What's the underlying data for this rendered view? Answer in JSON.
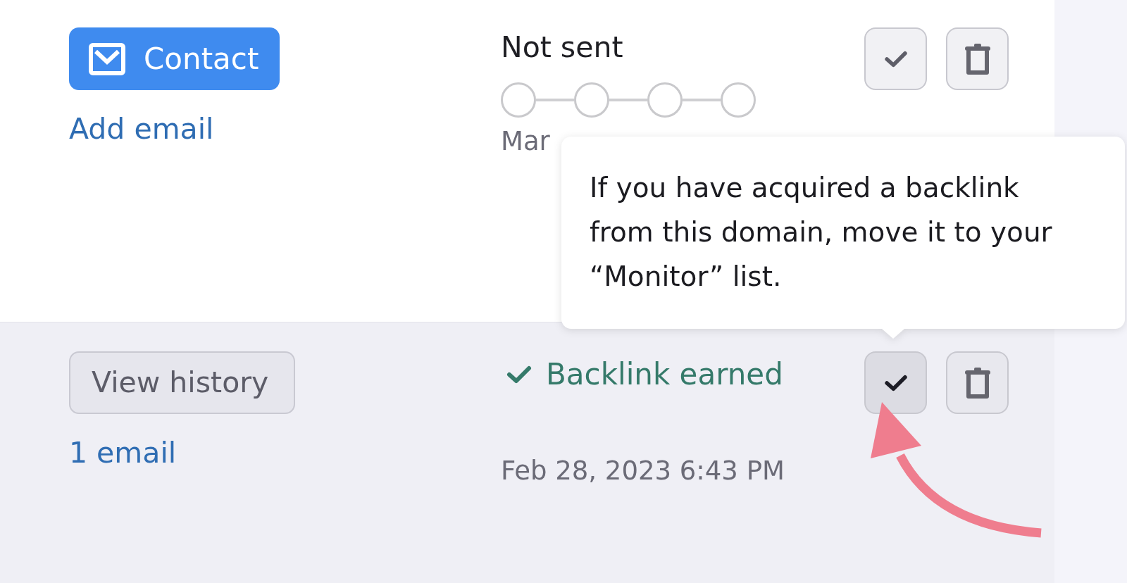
{
  "rows": [
    {
      "hovered": false,
      "action_button": {
        "kind": "contact",
        "label": "Contact"
      },
      "email_link": "Add email",
      "status": {
        "kind": "progress",
        "label": "Not sent",
        "steps": [
          {
            "done": false
          },
          {
            "done": false
          },
          {
            "done": false
          },
          {
            "done": false
          }
        ]
      },
      "date": "Mar",
      "done_button": {
        "hovered": false
      }
    },
    {
      "hovered": true,
      "action_button": {
        "kind": "history",
        "label": "View history"
      },
      "email_link": "1 email",
      "status": {
        "kind": "earned",
        "label": "Backlink earned"
      },
      "date": "Feb 28, 2023 6:43 PM",
      "done_button": {
        "hovered": true
      }
    }
  ],
  "tooltip": {
    "text": "If you have acquired a backlink from this domain, move it to your “Monitor” list."
  }
}
